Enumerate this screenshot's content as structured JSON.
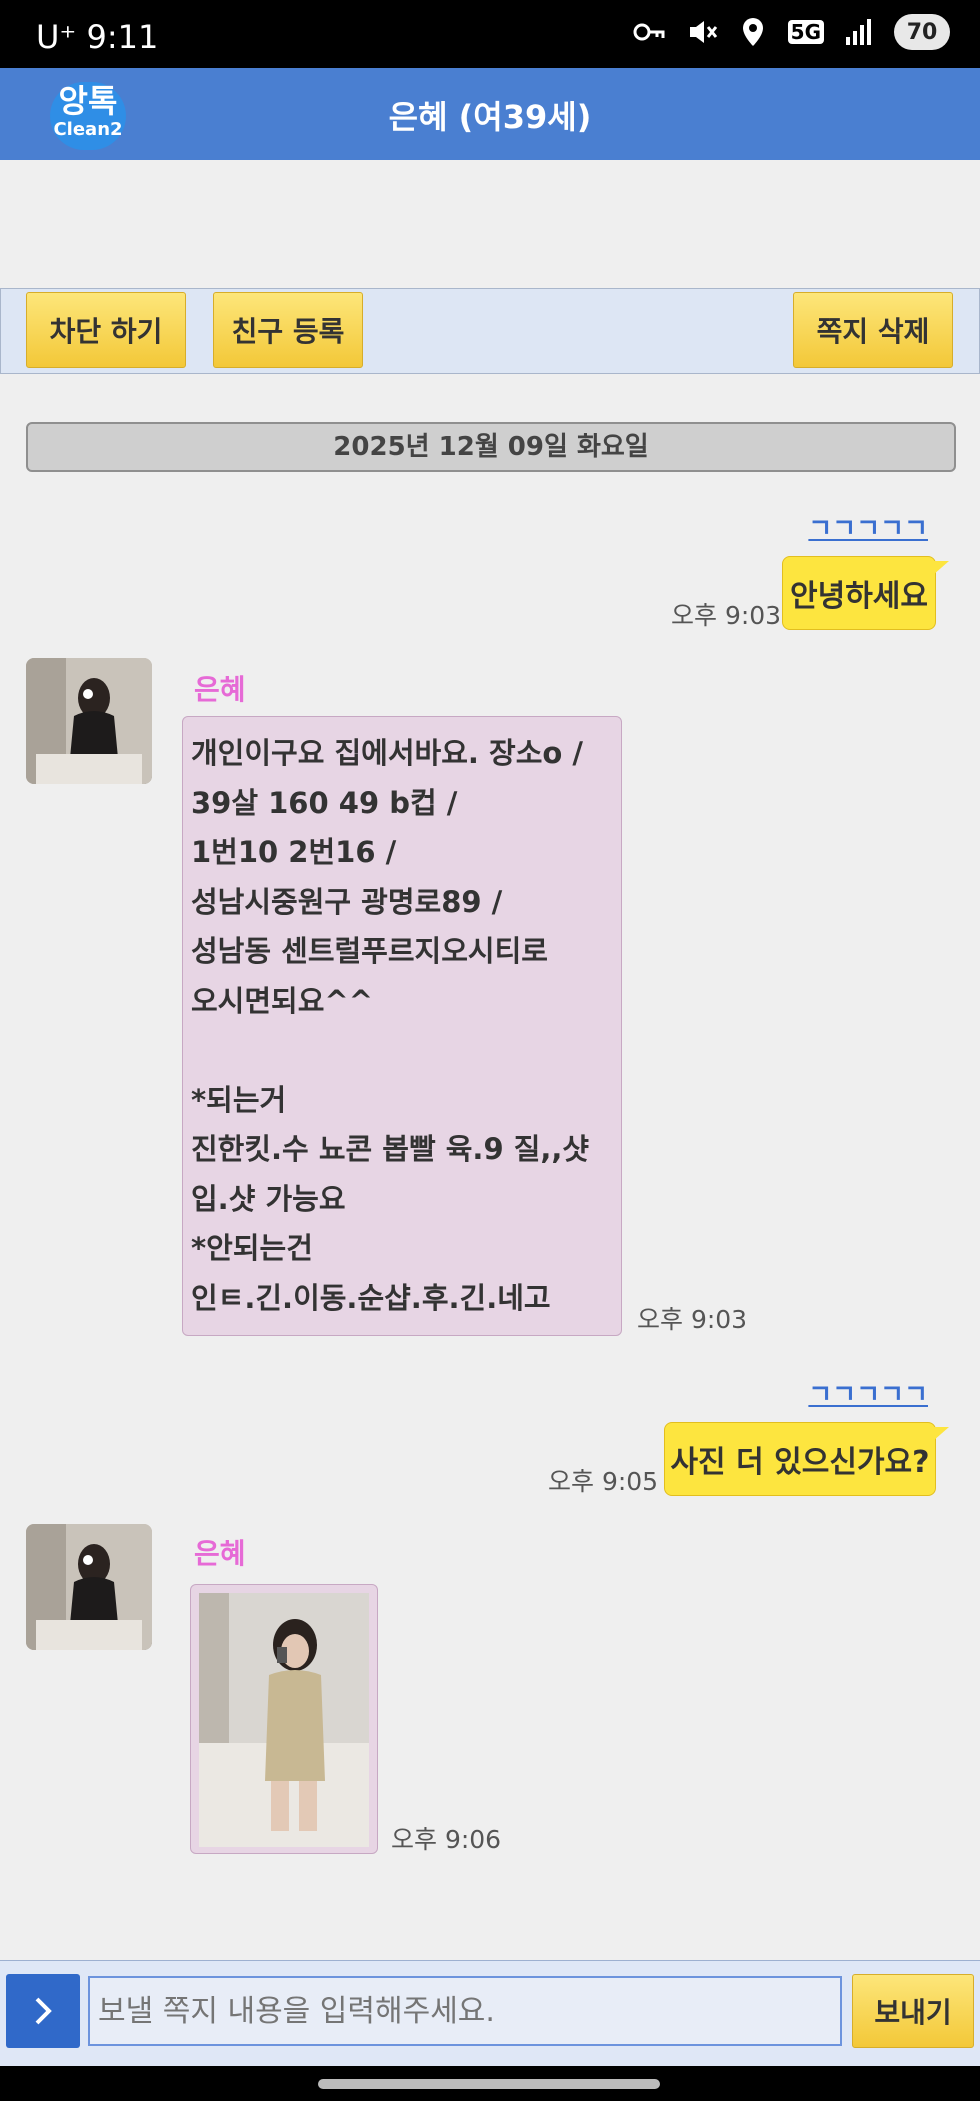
{
  "status_bar": {
    "carrier_time": "U⁺ 9:11",
    "network": "5G",
    "battery": "70",
    "icons": [
      "key-icon",
      "mute-icon",
      "location-icon",
      "5g-icon",
      "signal-icon",
      "battery-icon"
    ]
  },
  "header": {
    "logo_line1": "앙톡",
    "logo_line2": "Clean2",
    "title": "은혜 (여39세)"
  },
  "actions": {
    "block": "차단 하기",
    "add_friend": "친구 등록",
    "delete_note": "쪽지 삭제"
  },
  "date_divider": "2025년 12월 09일 화요일",
  "messages": [
    {
      "direction": "out",
      "sender": "ㄱㄱㄱㄱㄱ",
      "text": "안녕하세요",
      "time": "오후 9:03"
    },
    {
      "direction": "in",
      "sender": "은혜",
      "lines": [
        "개인이구요 집에서바요. 장소o /",
        "39살 160 49 b컵 /",
        "1번10  2번16 /",
        "성남시중원구 광명로89 /",
        "성남동 센트럴푸르지오시티로",
        "오시면되요^^",
        "",
        "*되는거",
        "진한킷.수 뇨콘 봅빨 육.9 질,,샷",
        "입.샷 가능요",
        "*안되는건",
        "인ㅌ.긴.이동.순샵.후.긴.네고"
      ],
      "time": "오후 9:03"
    },
    {
      "direction": "out",
      "sender": "ㄱㄱㄱㄱㄱ",
      "text": "사진 더 있으신가요?",
      "time": "오후 9:05"
    },
    {
      "direction": "in",
      "sender": "은혜",
      "type": "photo",
      "time": "오후 9:06"
    }
  ],
  "composer": {
    "placeholder": "보낼 쪽지 내용을 입력해주세요.",
    "send": "보내기"
  },
  "colors": {
    "header": "#4a7fd1",
    "yellow_button": "#f6d24d",
    "out_bubble": "#fde53f",
    "in_bubble": "#e7d5e4",
    "sender_name": "#e66ad6",
    "link": "#3a6fd0"
  }
}
